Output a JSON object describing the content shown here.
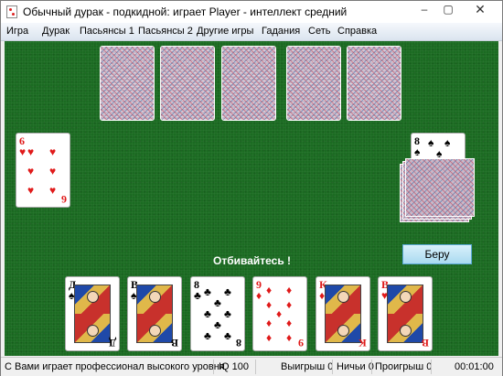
{
  "window": {
    "title": "Обычный дурак - подкидной: играет Player - интеллект средний",
    "controls": {
      "minimize": "–",
      "maximize": "▢",
      "close": "✕"
    }
  },
  "menu": [
    "Игра",
    "Дурак",
    "Пасьянсы 1",
    "Пасьянсы 2",
    "Другие игры",
    "Гадания",
    "Сеть",
    "Справка"
  ],
  "opponent": {
    "hidden_card_count": 5
  },
  "table_cards": {
    "attack": {
      "rank": "6",
      "suit": "♥",
      "color": "red"
    },
    "trump": {
      "rank": "8",
      "suit": "♠",
      "color": "black"
    }
  },
  "message": "Отбивайтесь !",
  "take_button": "Беру",
  "hand": [
    {
      "rank": "Д",
      "suit": "♠",
      "color": "black",
      "court": true
    },
    {
      "rank": "В",
      "suit": "♠",
      "color": "black",
      "court": true
    },
    {
      "rank": "8",
      "suit": "♣",
      "color": "black",
      "court": false
    },
    {
      "rank": "9",
      "suit": "♦",
      "color": "red",
      "court": false
    },
    {
      "rank": "К",
      "suit": "♦",
      "color": "red",
      "court": true
    },
    {
      "rank": "В",
      "suit": "♥",
      "color": "red",
      "court": true
    }
  ],
  "status": {
    "message": "С Вами играет профессионал высокого уровня",
    "iq": "IQ 100",
    "wins": "Выигрыш 0",
    "draws": "Ничьи 0",
    "losses": "Проигрыш 0",
    "time": "00:01:00"
  }
}
